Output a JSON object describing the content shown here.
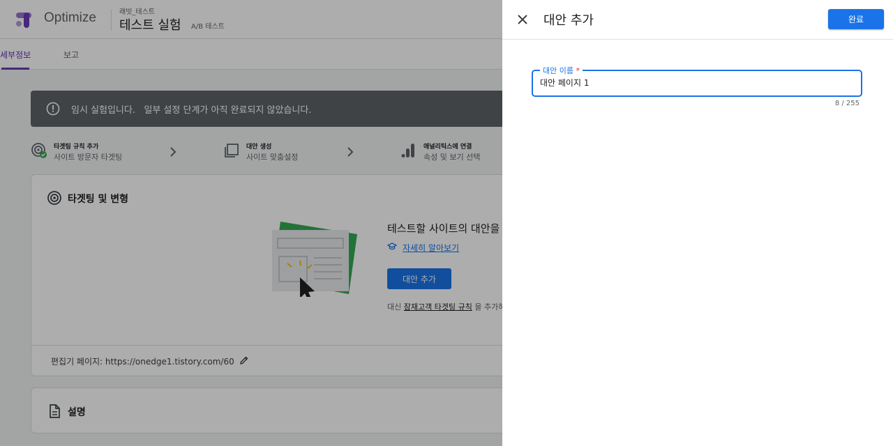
{
  "header": {
    "brand": "Optimize",
    "account": "래빗_테스트",
    "experiment_title": "테스트 실험",
    "experiment_type": "A/B 테스트"
  },
  "tabs": [
    {
      "label": "세부정보",
      "active": true
    },
    {
      "label": "보고",
      "active": false
    }
  ],
  "banner": {
    "text": "임시 실험입니다.   일부 설정 단계가 아직 완료되지 않았습니다."
  },
  "steps": [
    {
      "title": "타겟팅 규칙 추가",
      "subtitle": "사이트 방문자 타겟팅",
      "icon": "target-check-icon"
    },
    {
      "title": "대안 생성",
      "subtitle": "사이트 맞춤설정",
      "icon": "copy-icon"
    },
    {
      "title": "애널리틱스에 연결",
      "subtitle": "속성 및 보기 선택",
      "icon": "analytics-icon"
    }
  ],
  "targeting_card": {
    "title": "타겟팅 및 변형",
    "hero_title": "테스트할 사이트의 대안을",
    "learn_more": "자세히 알아보기",
    "add_variant_button": "대안 추가",
    "audience_prefix": "대신",
    "audience_link": "잠재고객 타겟팅 규칙",
    "audience_suffix": "을 추가하",
    "editor_page": "편집기 페이지: https://onedge1.tistory.com/60"
  },
  "description_card": {
    "title": "설명"
  },
  "panel": {
    "title": "대안 추가",
    "done_button": "완료",
    "field_label": "대안 이름",
    "field_required": "*",
    "field_value": "대안 페이지 1",
    "counter": "8 / 255"
  },
  "colors": {
    "primary": "#1a73e8",
    "brand_purple": "#673ab7",
    "banner_bg": "#5f6368",
    "required": "#d93025"
  }
}
